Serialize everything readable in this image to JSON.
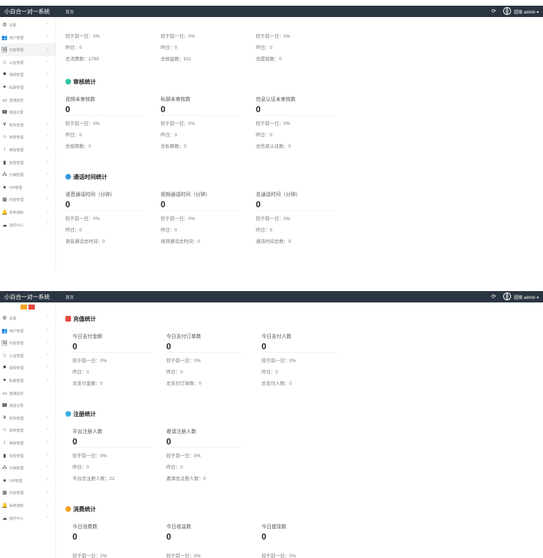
{
  "app": {
    "title": "小白合一对一系统",
    "user": "超级 admin ▾",
    "refresh_icon": "refresh-icon",
    "language_icon": "globe-icon"
  },
  "menu": [
    {
      "icon": "⚙",
      "label": "设置"
    },
    {
      "icon": "👥",
      "label": "用户管理"
    },
    {
      "icon": "🖼",
      "label": "内容管理"
    },
    {
      "icon": "☆",
      "label": "认证管理"
    },
    {
      "icon": "■",
      "label": "视频管理"
    },
    {
      "icon": "●",
      "label": "私聊管理"
    },
    {
      "icon": "▭",
      "label": "直播监控"
    },
    {
      "icon": "☎",
      "label": "通话记录"
    },
    {
      "icon": "¥",
      "label": "财务管理"
    },
    {
      "icon": "⌂",
      "label": "家族管理"
    },
    {
      "icon": "↕",
      "label": "等级管理"
    },
    {
      "icon": "▮",
      "label": "标签管理"
    },
    {
      "icon": "⁂",
      "label": "分销管理"
    },
    {
      "icon": "★",
      "label": "VIP管理"
    },
    {
      "icon": "▦",
      "label": "内容管理"
    },
    {
      "icon": "🔔",
      "label": "系统通知"
    },
    {
      "icon": "☁",
      "label": "插件中心"
    }
  ],
  "panel1": {
    "tab": "首页",
    "top_section": {
      "cols": [
        {
          "r1": "较于前一日：0%",
          "r2": "昨日：0",
          "r3": "总消费数：1799"
        },
        {
          "r1": "较于前一日：0%",
          "r2": "昨日：0",
          "r3": "总收益数：811"
        },
        {
          "r1": "较于前一日：0%",
          "r2": "昨日：0",
          "r3": "总提现数：0"
        }
      ]
    },
    "audit": {
      "title": "审核统计",
      "cols": [
        {
          "label": "视频未审核数",
          "value": "0",
          "r1": "较于前一日：0%",
          "r2": "昨日：0",
          "r3": "总视频数：0"
        },
        {
          "label": "私聊未审核数",
          "value": "0",
          "r1": "较于前一日：0%",
          "r2": "昨日：0",
          "r3": "总私聊数：0"
        },
        {
          "label": "信息认证未审核数",
          "value": "0",
          "r1": "较于前一日：0%",
          "r2": "昨日：0",
          "r3": "总信息认证数：0"
        }
      ]
    },
    "calltime": {
      "title": "通话时间统计",
      "cols": [
        {
          "label": "语音通话时间（分钟）",
          "value": "0",
          "r1": "较于前一日：0%",
          "r2": "昨日：0",
          "r3": "语音通话总时间：0"
        },
        {
          "label": "视频通话时间（分钟）",
          "value": "0",
          "r1": "较于前一日：0%",
          "r2": "昨日：0",
          "r3": "视频通话总时间：0"
        },
        {
          "label": "总通话时间（分钟）",
          "value": "0",
          "r1": "较于前一日：0%",
          "r2": "昨日：0",
          "r3": "通话时间总数：0"
        }
      ]
    }
  },
  "panel2": {
    "tab": "首页",
    "recharge": {
      "title": "充值统计",
      "cols": [
        {
          "label": "今日支付金额",
          "value": "0",
          "r1": "较于前一日：0%",
          "r2": "昨日：0",
          "r3": "总支付金额：0"
        },
        {
          "label": "今日支付订单数",
          "value": "0",
          "r1": "较于前一日：0%",
          "r2": "昨日：0",
          "r3": "总支付订单数：0"
        },
        {
          "label": "今日支付人数",
          "value": "0",
          "r1": "较于前一日：0%",
          "r2": "昨日：0",
          "r3": "总支付人数：0"
        }
      ]
    },
    "register": {
      "title": "注册统计",
      "cols": [
        {
          "label": "平台注册人数",
          "value": "0",
          "r1": "较于前一日：0%",
          "r2": "昨日：0",
          "r3": "平台总注册人数：22"
        },
        {
          "label": "邀请注册人数",
          "value": "0",
          "r1": "较于前一日：0%",
          "r2": "昨日：0",
          "r3": "邀请总注册人数：0"
        }
      ]
    },
    "consume": {
      "title": "消费统计",
      "cols": [
        {
          "label": "今日消费数",
          "value": "0",
          "r1": "较于前一日：0%"
        },
        {
          "label": "今日收益数",
          "value": "0",
          "r1": "较于前一日：0%"
        },
        {
          "label": "今日提现数",
          "value": "0",
          "r1": "较于前一日：0%"
        }
      ]
    }
  },
  "colors": {
    "topbar": "#2b3542",
    "audit_icon": "#2ec4a6",
    "calltime_icon": "#3a9bdc",
    "recharge_icon": "#e8483d",
    "register_icon": "#3ab0e0",
    "consume_icon": "#f6a623"
  }
}
